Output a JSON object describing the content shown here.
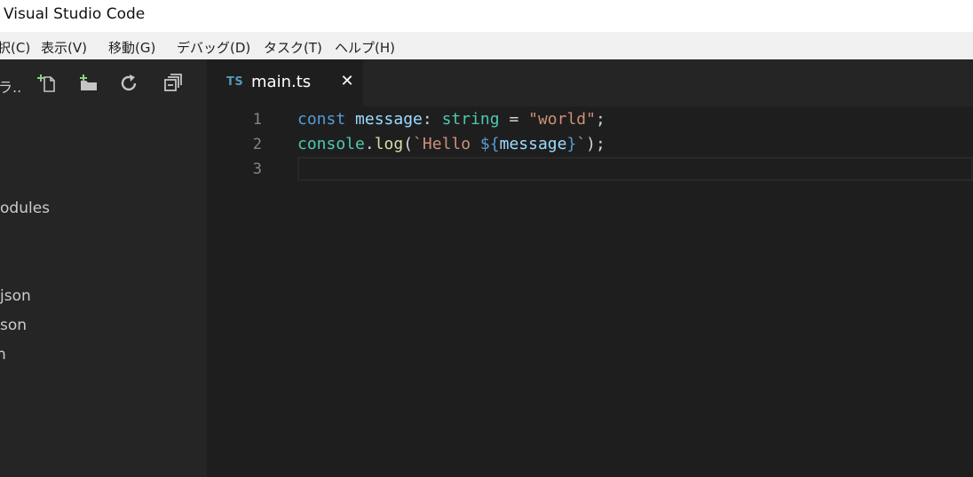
{
  "window": {
    "title": "Visual Studio Code"
  },
  "menubar": {
    "items": [
      "択(C)",
      "表示(V)",
      "移動(G)",
      "デバッグ(D)",
      "タスク(T)",
      "ヘルプ(H)"
    ]
  },
  "sidebar": {
    "header": "ラ..",
    "icons": [
      "new-file-icon",
      "new-folder-icon",
      "refresh-icon",
      "collapse-all-icon"
    ],
    "items": [
      "odules",
      "json",
      "son",
      "n"
    ]
  },
  "editor": {
    "tab": {
      "lang_badge": "TS",
      "filename": "main.ts",
      "close_glyph": "✕"
    },
    "lines": [
      {
        "number": "1",
        "tokens": [
          {
            "text": "const",
            "color": "#569cd6"
          },
          {
            "text": " ",
            "color": "#d4d4d4"
          },
          {
            "text": "message",
            "color": "#9cdcfe"
          },
          {
            "text": ": ",
            "color": "#d4d4d4"
          },
          {
            "text": "string",
            "color": "#4ec9b0"
          },
          {
            "text": " = ",
            "color": "#d4d4d4"
          },
          {
            "text": "\"world\"",
            "color": "#ce9178"
          },
          {
            "text": ";",
            "color": "#d4d4d4"
          }
        ]
      },
      {
        "number": "2",
        "tokens": [
          {
            "text": "console",
            "color": "#4ec9b0"
          },
          {
            "text": ".",
            "color": "#d4d4d4"
          },
          {
            "text": "log",
            "color": "#dcdcaa"
          },
          {
            "text": "(",
            "color": "#d4d4d4"
          },
          {
            "text": "`Hello ",
            "color": "#ce9178"
          },
          {
            "text": "${",
            "color": "#569cd6"
          },
          {
            "text": "message",
            "color": "#9cdcfe"
          },
          {
            "text": "}",
            "color": "#569cd6"
          },
          {
            "text": "`",
            "color": "#ce9178"
          },
          {
            "text": ");",
            "color": "#d4d4d4"
          }
        ]
      },
      {
        "number": "3",
        "tokens": []
      }
    ]
  },
  "colors": {
    "editor_bg": "#1e1e1e",
    "sidebar_bg": "#252526",
    "ts_badge": "#519aba"
  }
}
